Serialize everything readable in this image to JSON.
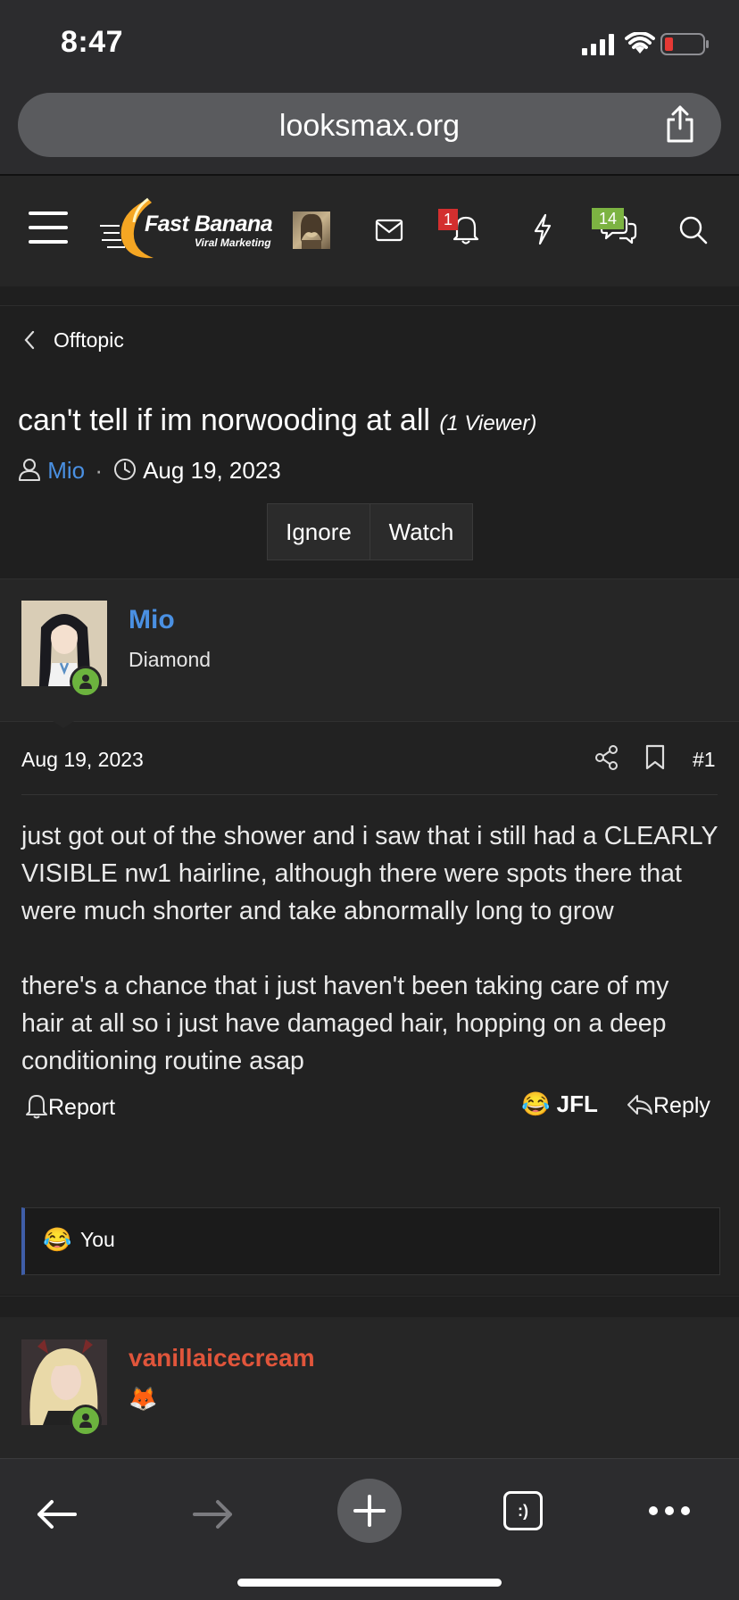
{
  "status": {
    "time": "8:47"
  },
  "browser": {
    "url": "looksmax.org"
  },
  "header": {
    "logo_title": "Fast Banana",
    "logo_subtitle": "Viral Marketing",
    "alerts_count": "1",
    "conversations_count": "14"
  },
  "breadcrumb": {
    "label": "Offtopic"
  },
  "thread": {
    "title": "can't tell if im norwooding at all",
    "viewers": "(1 Viewer)",
    "author": "Mio",
    "separator": "·",
    "date": "Aug 19, 2023",
    "ignore_label": "Ignore",
    "watch_label": "Watch"
  },
  "post": {
    "username": "Mio",
    "user_title": "Diamond",
    "date": "Aug 19, 2023",
    "number": "#1",
    "paragraphs": [
      "just got out of the shower and i saw that i still had a CLEARLY VISIBLE nw1 hairline, although there were spots there that were much shorter and take abnormally long to grow",
      "there's a chance that i just haven't been taking care of my hair at all so i just have damaged hair, hopping on a deep conditioning routine asap"
    ],
    "report_label": "Report",
    "reaction_label": "JFL",
    "reply_label": "Reply",
    "reaction_emoji": "😂",
    "reactions_by": "You"
  },
  "next_post": {
    "username": "vanillaicecream",
    "user_title_emoji": "🦊"
  },
  "colors": {
    "link_blue": "#4a90e2",
    "username_red": "#e0553b",
    "online_green": "#6cb33e",
    "alert_badge": "#d32f2f",
    "conv_badge": "#7cb342"
  }
}
